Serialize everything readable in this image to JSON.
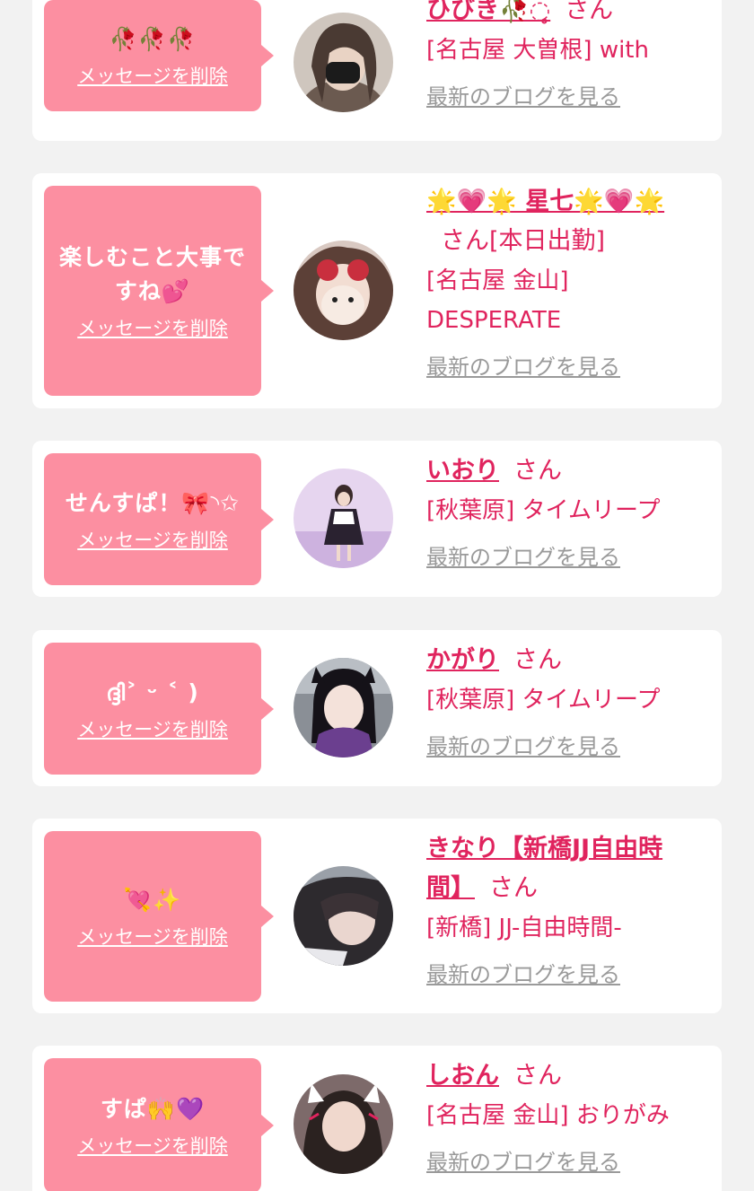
{
  "colors": {
    "page_bg": "#f2f2f2",
    "card_bg": "#ffffff",
    "bubble": "#fc8fa1",
    "accent": "#e0245e",
    "link_gray": "#9a9a9a"
  },
  "common": {
    "delete_label": "メッセージを削除",
    "san_label": "さん",
    "blog_label": "最新のブログを見る"
  },
  "messages": [
    {
      "message": "🥀🥀🥀",
      "name": "ひびき🥀◌̥",
      "name_suffix": "",
      "shop": "[名古屋 大曽根] with",
      "avatar_icon": "avatar-photo-icon"
    },
    {
      "message": "楽しむこと大事ですね💕",
      "name": "🌟💗🌟 星七🌟💗🌟",
      "name_suffix": "[本日出勤]",
      "shop": "[名古屋 金山] DESPERATE",
      "avatar_icon": "avatar-photo-icon"
    },
    {
      "message": "せんすぱ！🎀◝✩",
      "name": "いおり",
      "name_suffix": "",
      "shop": "[秋葉原] タイムリープ",
      "avatar_icon": "avatar-photo-icon"
    },
    {
      "message": "ദ്ദി˃ ᵕ ˂ )",
      "name": "かがり",
      "name_suffix": "",
      "shop": "[秋葉原] タイムリープ",
      "avatar_icon": "avatar-photo-icon"
    },
    {
      "message": "💘✨",
      "name": "きなり【新橋JJ自由時間】",
      "name_suffix": "",
      "shop": "[新橋] JJ-自由時間-",
      "avatar_icon": "avatar-photo-icon"
    },
    {
      "message": "すぱ🙌💜",
      "name": "しおん",
      "name_suffix": "",
      "shop": "[名古屋 金山] おりがみ",
      "avatar_icon": "avatar-photo-icon"
    }
  ]
}
